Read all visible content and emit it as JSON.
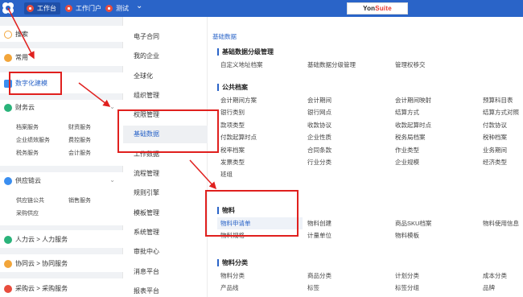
{
  "topbar": {
    "tabs": [
      {
        "label": "工作台"
      },
      {
        "label": "工作门户"
      },
      {
        "label": "测试"
      }
    ],
    "brand_main": "Yon",
    "brand_accent": "Suite"
  },
  "sidebar": {
    "search": "搜索",
    "common": "常用",
    "digital": "数字化建模",
    "finance": {
      "title": "财务云",
      "items": [
        "档案服务",
        "财资服务",
        "企业绩效服务",
        "费控服务",
        "税务服务",
        "会计服务"
      ]
    },
    "supply": {
      "title": "供应链云",
      "items": [
        "供应链公共",
        "销售服务",
        "采购供应"
      ]
    },
    "hr": "人力云 > 人力服务",
    "collab": "协同云 > 协同服务",
    "purchase": "采购云 > 采购服务"
  },
  "midmenu": {
    "items": [
      "电子合同",
      "我的企业",
      "全球化",
      "组织管理",
      "权限管理",
      "基础数据",
      "工作数据",
      "流程管理",
      "规则引擎",
      "模板管理",
      "系统管理",
      "审批中心",
      "消息平台",
      "报表平台"
    ],
    "active_index": 5
  },
  "content": {
    "breadcrumb": "基础数据",
    "sections": [
      {
        "title": "基础数据分级管理",
        "rows": [
          [
            "自定义地址档案",
            "基础数据分级管理",
            "管理权移交",
            ""
          ]
        ]
      },
      {
        "title": "公共档案",
        "rows": [
          [
            "会计期间方案",
            "会计期间",
            "会计期间映射",
            "预算科目表"
          ],
          [
            "银行类别",
            "银行网点",
            "结算方式",
            "结算方式对照"
          ],
          [
            "款项类型",
            "收款协议",
            "收款起算时点",
            "付款协议"
          ],
          [
            "付款起算时点",
            "企业性质",
            "税务局档案",
            "税种档案"
          ],
          [
            "税率档案",
            "合同条款",
            "作业类型",
            "业务期间"
          ],
          [
            "发票类型",
            "行业分类",
            "企业规模",
            "经济类型"
          ],
          [
            "班组",
            "",
            "",
            ""
          ]
        ]
      },
      {
        "title": "物料",
        "rows": [
          [
            "物料申请单",
            "物料创建",
            "商品SKU档案",
            "物料使用信息"
          ],
          [
            "物料规格",
            "计量单位",
            "物料模板",
            ""
          ]
        ]
      },
      {
        "title": "物料分类",
        "rows": [
          [
            "物料分类",
            "商品分类",
            "计划分类",
            "成本分类"
          ],
          [
            "产品线",
            "标签",
            "标签分组",
            "品牌"
          ]
        ]
      }
    ]
  },
  "colors": {
    "topbar": "#2a64c8",
    "accent": "#2a64c8",
    "annotation": "#e0201e"
  }
}
